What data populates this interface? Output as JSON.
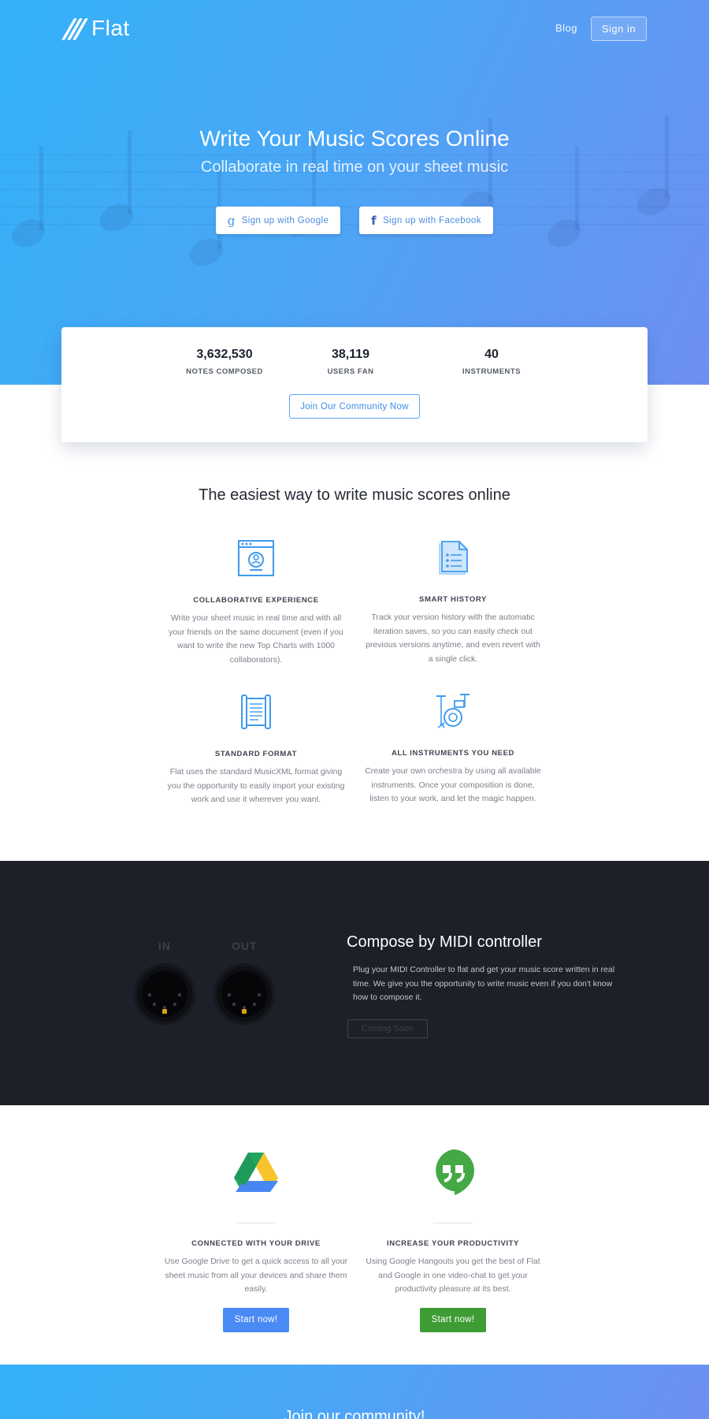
{
  "brand": {
    "name": "Flat"
  },
  "nav": {
    "blog": "Blog",
    "sign_in": "Sign in"
  },
  "hero": {
    "title": "Write Your Music Scores Online",
    "subtitle": "Collaborate in real time on your sheet music",
    "google_button": "Sign up with Google",
    "facebook_button": "Sign up with Facebook"
  },
  "stats": {
    "items": [
      {
        "value": "3,632,530",
        "label": "NOTES COMPOSED"
      },
      {
        "value": "38,119",
        "label": "USERS FAN"
      },
      {
        "value": "40",
        "label": "INSTRUMENTS"
      }
    ],
    "join_button": "Join Our Community Now"
  },
  "features": {
    "title": "The easiest way to write music scores online",
    "items": [
      {
        "title": "COLLABORATIVE EXPERIENCE",
        "desc": "Write your sheet music in real time and with all your friends on the same document (even if you want to write the new Top Charts with 1000 collaborators).",
        "icon": "collaboration-window-icon"
      },
      {
        "title": "SMART HISTORY",
        "desc": "Track your version history with the automatic iteration saves, so you can easily check out previous versions anytime, and even revert with a single click.",
        "icon": "history-document-icon"
      },
      {
        "title": "STANDARD FORMAT",
        "desc": "Flat uses the standard MusicXML format giving you the opportunity to easily import your existing work and use it wherever you want.",
        "icon": "scroll-format-icon"
      },
      {
        "title": "ALL INSTRUMENTS YOU NEED",
        "desc": "Create your own orchestra by using all available instruments. Once your composition is done, listen to your work, and let the magic happen.",
        "icon": "drum-kit-icon"
      }
    ]
  },
  "midi": {
    "in_label": "IN",
    "out_label": "OUT",
    "title": "Compose by MIDI controller",
    "desc": "Plug your MIDI Controller to flat and get your music score written in real time. We give you the opportunity to write music even if you don't know how to compose it.",
    "button": "Coming Soon"
  },
  "integrations": {
    "items": [
      {
        "title": "CONNECTED WITH YOUR DRIVE",
        "desc": "Use Google Drive to get a quick access to all your sheet music from all your devices and share them easily.",
        "button": "Start now!",
        "color": "#4a8af4",
        "icon": "google-drive-icon"
      },
      {
        "title": "INCREASE YOUR PRODUCTIVITY",
        "desc": "Using Google Hangouts you get the best of Flat and Google in one video-chat to get your productivity pleasure at its best.",
        "button": "Start now!",
        "color": "#3f9c35",
        "icon": "google-hangouts-icon"
      }
    ]
  },
  "community": {
    "title": "Join our community!"
  },
  "colors": {
    "hero_start": "#33b1f8",
    "hero_end": "#6e8ff2",
    "accent": "#4a8fe8",
    "midi_bg": "#1d2029"
  }
}
